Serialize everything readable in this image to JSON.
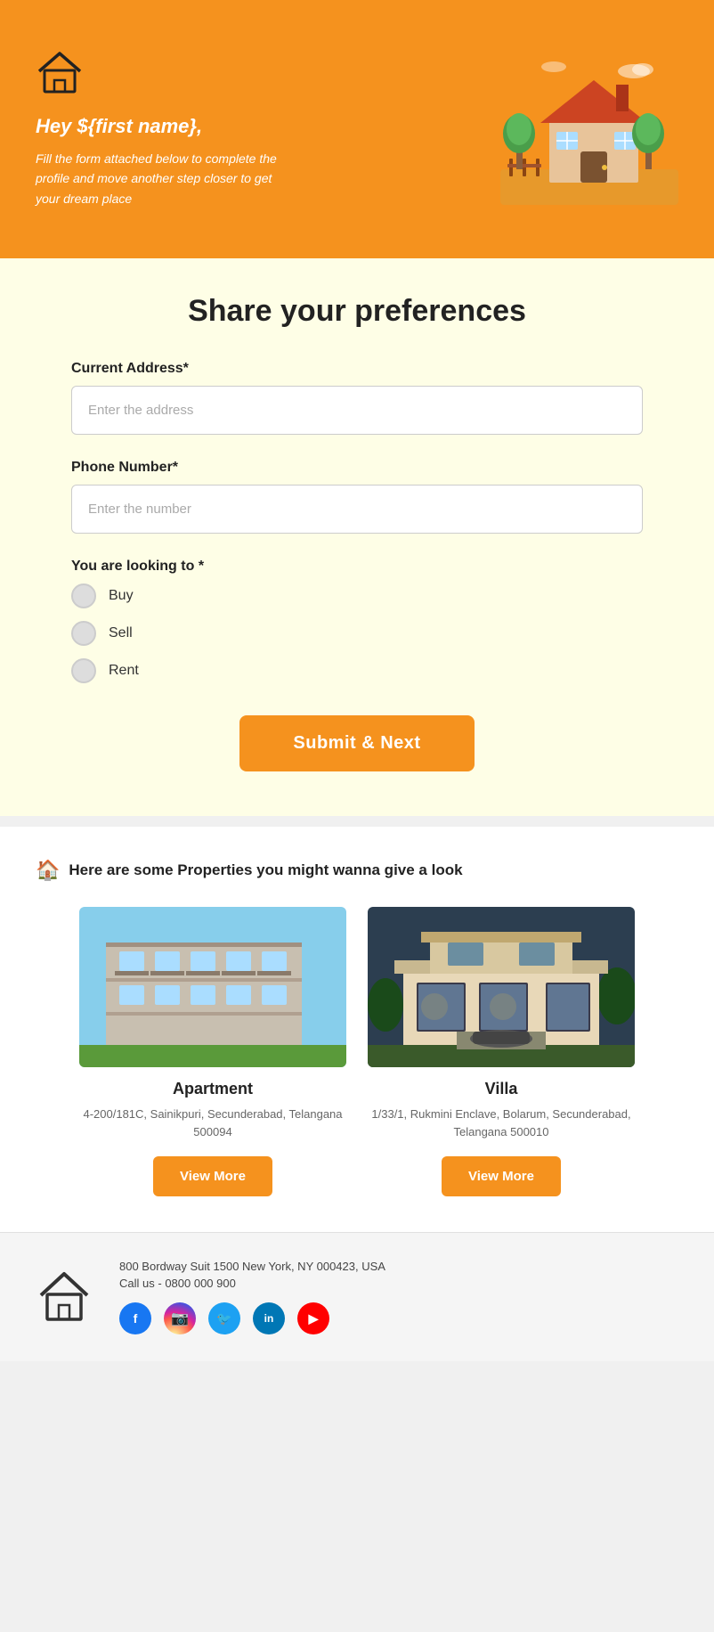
{
  "hero": {
    "greeting": "Hey ${first name},",
    "subtitle": "Fill the form attached below to complete the profile and move another step closer to get your dream place",
    "home_icon_label": "home icon"
  },
  "form": {
    "title": "Share your preferences",
    "address_label": "Current Address*",
    "address_placeholder": "Enter the address",
    "phone_label": "Phone Number*",
    "phone_placeholder": "Enter the number",
    "looking_label": "You are looking to *",
    "options": [
      {
        "value": "buy",
        "label": "Buy"
      },
      {
        "value": "sell",
        "label": "Sell"
      },
      {
        "value": "rent",
        "label": "Rent"
      }
    ],
    "submit_label": "Submit & Next"
  },
  "properties": {
    "section_header": "Here are some Properties you might wanna give a look",
    "items": [
      {
        "name": "Apartment",
        "address": "4-200/181C, Sainikpuri, Secunderabad, Telangana 500094",
        "btn_label": "View More"
      },
      {
        "name": "Villa",
        "address": "1/33/1, Rukmini Enclave, Bolarum, Secunderabad, Telangana 500010",
        "btn_label": "View More"
      }
    ]
  },
  "footer": {
    "address": "800 Bordway Suit 1500 New York, NY 000423, USA",
    "phone_label": "Call us -",
    "phone": "0800 000 900",
    "social": [
      {
        "name": "Facebook",
        "class": "fb",
        "symbol": "f"
      },
      {
        "name": "Instagram",
        "class": "ig",
        "symbol": "📷"
      },
      {
        "name": "Twitter",
        "class": "tw",
        "symbol": "🐦"
      },
      {
        "name": "LinkedIn",
        "class": "li",
        "symbol": "in"
      },
      {
        "name": "YouTube",
        "class": "yt",
        "symbol": "▶"
      }
    ]
  }
}
